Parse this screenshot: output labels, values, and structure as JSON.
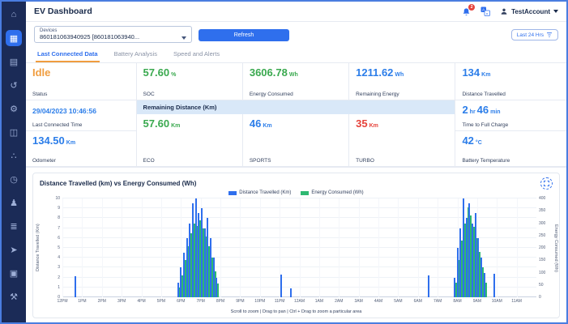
{
  "colors": {
    "accent": "#2f6fed",
    "green": "#3aa94f",
    "orange": "#f09d3f",
    "red": "#e6433b",
    "blue": "#2b7de9",
    "sidebar_bg": "#1b2b57",
    "strip_bg": "#d9e8f8"
  },
  "sidebar": {
    "items": [
      {
        "name": "home-icon",
        "glyph": "⌂",
        "active": false
      },
      {
        "name": "dashboard-icon",
        "glyph": "▦",
        "active": true
      },
      {
        "name": "reports-icon",
        "glyph": "▤",
        "active": false
      },
      {
        "name": "history-icon",
        "glyph": "↺",
        "active": false
      },
      {
        "name": "settings-icon",
        "glyph": "⚙",
        "active": false
      },
      {
        "name": "analytics-icon",
        "glyph": "◫",
        "active": false
      },
      {
        "name": "connections-icon",
        "glyph": "∴",
        "active": false
      },
      {
        "name": "timer-icon",
        "glyph": "◷",
        "active": false
      },
      {
        "name": "add-user-icon",
        "glyph": "♟",
        "active": false
      },
      {
        "name": "controls-icon",
        "glyph": "≣",
        "active": false
      },
      {
        "name": "launch-icon",
        "glyph": "➤",
        "active": false
      },
      {
        "name": "package-icon",
        "glyph": "▣",
        "active": false
      },
      {
        "name": "tools-icon",
        "glyph": "⚒",
        "active": false
      }
    ]
  },
  "header": {
    "title": "EV Dashboard",
    "notification_count": "2",
    "account": "TestAccount"
  },
  "toolbar": {
    "devices_label": "Devices",
    "device_value": "860181063940925 [860181063940...",
    "refresh_label": "Refresh",
    "time_filter": "Last 24 Hrs"
  },
  "tabs": [
    {
      "label": "Last Connected Data",
      "active": true
    },
    {
      "label": "Battery Analysis",
      "active": false
    },
    {
      "label": "Speed and Alerts",
      "active": false
    }
  ],
  "stats": {
    "status": {
      "value": "Idle",
      "label": "Status",
      "color": "#f09d3f"
    },
    "soc": {
      "value": "57.60",
      "unit": "%",
      "label": "SOC",
      "color": "#3aa94f"
    },
    "energy_consumed": {
      "value": "3606.78",
      "unit": "Wh",
      "label": "Energy Consumed",
      "color": "#3aa94f"
    },
    "remaining_energy": {
      "value": "1211.62",
      "unit": "Wh",
      "label": "Remaining Energy",
      "color": "#2b7de9"
    },
    "distance_travelled": {
      "value": "134",
      "unit": "Km",
      "label": "Distance Travelled",
      "color": "#2b7de9"
    },
    "last_connected": {
      "value": "29/04/2023 10:46:56",
      "label": "Last Connected Time",
      "color": "#2b7de9"
    },
    "remaining_distance_header": "Remaining Distance (Km)",
    "time_to_full": {
      "h": "2",
      "h_unit": "hr",
      "m": "46",
      "m_unit": "min",
      "label": "Time to Full Charge",
      "color": "#2b7de9"
    },
    "odometer": {
      "value": "134.50",
      "unit": "Km",
      "label": "Odometer",
      "color": "#2b7de9"
    },
    "eco": {
      "value": "57.60",
      "unit": "Km",
      "label": "ECO",
      "color": "#3aa94f"
    },
    "sports": {
      "value": "46",
      "unit": "Km",
      "label": "SPORTS",
      "color": "#2b7de9"
    },
    "turbo": {
      "value": "35",
      "unit": "Km",
      "label": "TURBO",
      "color": "#e6433b"
    },
    "battery_temp": {
      "value": "42",
      "unit": "°C",
      "label": "Battery Temperature",
      "color": "#2b7de9"
    }
  },
  "chart_data": {
    "type": "bar",
    "title": "Distance Travelled (km) vs Energy Consumed (Wh)",
    "footer": "Scroll to zoom | Drag to pan | Ctrl + Drag to zoom a particular area",
    "x_labels": [
      "12PM",
      "1PM",
      "2PM",
      "3PM",
      "4PM",
      "5PM",
      "6PM",
      "7PM",
      "8PM",
      "9PM",
      "10PM",
      "11PM",
      "12AM",
      "1AM",
      "2AM",
      "3AM",
      "4AM",
      "5AM",
      "6AM",
      "7AM",
      "8AM",
      "9AM",
      "10AM",
      "11AM"
    ],
    "hours_span": 24,
    "left_axis": {
      "label": "Distance Travelled (Km)",
      "min": 0,
      "max": 10,
      "step": 1
    },
    "right_axis": {
      "label": "Energy Consumed (Wh)",
      "min": 0,
      "max": 400,
      "step": 50
    },
    "series": [
      {
        "name": "Distance Travelled (Km)",
        "color": "#2f6fed",
        "axis": "left"
      },
      {
        "name": "Energy Consumed (Wh)",
        "color": "#2eb872",
        "axis": "right"
      }
    ],
    "columns": [
      "hours_after_12pm",
      "distance_km",
      "energy_wh"
    ],
    "points": [
      [
        0.7,
        2.1,
        0
      ],
      [
        5.9,
        1.5,
        40
      ],
      [
        6.05,
        3,
        90
      ],
      [
        6.2,
        4.5,
        150
      ],
      [
        6.35,
        6,
        205
      ],
      [
        6.5,
        7.5,
        260
      ],
      [
        6.65,
        9.5,
        300
      ],
      [
        6.8,
        10,
        290
      ],
      [
        6.95,
        8.5,
        310
      ],
      [
        7.1,
        9,
        280
      ],
      [
        7.25,
        7,
        245
      ],
      [
        7.4,
        8,
        205
      ],
      [
        7.55,
        6,
        160
      ],
      [
        7.7,
        4,
        105
      ],
      [
        7.85,
        2,
        55
      ],
      [
        11.1,
        2.3,
        0
      ],
      [
        11.6,
        0.9,
        0
      ],
      [
        18.6,
        2.2,
        0
      ],
      [
        19.9,
        2,
        60
      ],
      [
        20.05,
        5,
        150
      ],
      [
        20.2,
        7,
        230
      ],
      [
        20.35,
        10,
        300
      ],
      [
        20.5,
        8,
        365
      ],
      [
        20.65,
        9.5,
        330
      ],
      [
        20.8,
        7.5,
        285
      ],
      [
        20.95,
        8.5,
        240
      ],
      [
        21.1,
        6,
        185
      ],
      [
        21.25,
        4,
        120
      ],
      [
        21.4,
        2.5,
        60
      ],
      [
        21.9,
        2.4,
        0
      ]
    ]
  }
}
